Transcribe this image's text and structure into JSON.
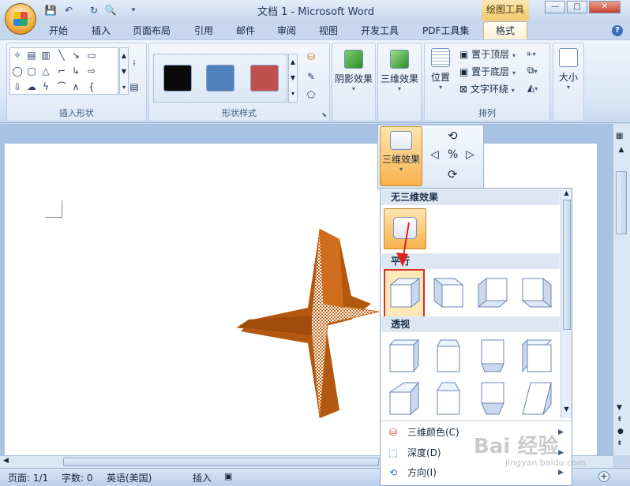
{
  "window": {
    "title": "文档 1 - Microsoft Word",
    "context_tab_group": "绘图工具",
    "minimize": "—",
    "maximize": "□",
    "close": "✕"
  },
  "tabs": [
    "开始",
    "插入",
    "页面布局",
    "引用",
    "邮件",
    "审阅",
    "视图",
    "开发工具",
    "PDF工具集",
    "格式"
  ],
  "active_tab": "格式",
  "ribbon": {
    "insert_shapes_label": "插入形状",
    "shape_styles_label": "形状样式",
    "shadow_effects": "阴影效果",
    "threed_effects": "三维效果",
    "arrange_label": "排列",
    "position": "位置",
    "bring_to_front": "置于顶层",
    "send_to_back": "置于底层",
    "text_wrap": "文字环绕",
    "size": "大小",
    "swatch_colors": [
      "#0a0a0a",
      "#4f81bd",
      "#c0504d"
    ]
  },
  "dropdown": {
    "threed_button": "三维效果",
    "no_3d": "无三维效果",
    "parallel": "平行",
    "perspective": "透视",
    "menu": [
      {
        "label": "三维颜色(C)",
        "icon": "paint-bucket-icon"
      },
      {
        "label": "深度(D)",
        "icon": "depth-icon"
      },
      {
        "label": "方向(I)",
        "icon": "direction-icon"
      }
    ]
  },
  "status": {
    "page": "页面: 1/1",
    "words": "字数: 0",
    "language": "英语(美国)",
    "mode": "插入"
  },
  "watermark": {
    "main": "Bai 经验",
    "sub": "jingyan.baidu.com"
  },
  "shape_color": "#c8661a"
}
